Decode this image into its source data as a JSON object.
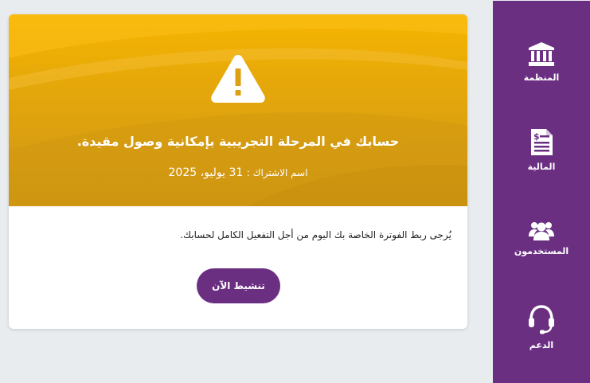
{
  "sidebar": {
    "items": [
      {
        "label": "المنظمة",
        "icon": "bank-icon"
      },
      {
        "label": "المالية",
        "icon": "invoice-icon"
      },
      {
        "label": "المستخدمون",
        "icon": "users-icon"
      },
      {
        "label": "الدعم",
        "icon": "headset-icon"
      }
    ]
  },
  "banner": {
    "icon": "warning-icon",
    "title": "حسابك في المرحلة التجريبية بإمكانية وصول مقيدة.",
    "subscription_label": "اسم الاشتراك :",
    "subscription_date": "31 يوليو، 2025"
  },
  "body": {
    "message": "يُرجى ربط الفوترة الخاصة بك اليوم من أجل التفعيل الكامل لحسابك.",
    "activate_label": "تنشيط الآن"
  },
  "colors": {
    "brand": "#6b2f82",
    "banner": "#f0b000",
    "background": "#e9ecef"
  }
}
